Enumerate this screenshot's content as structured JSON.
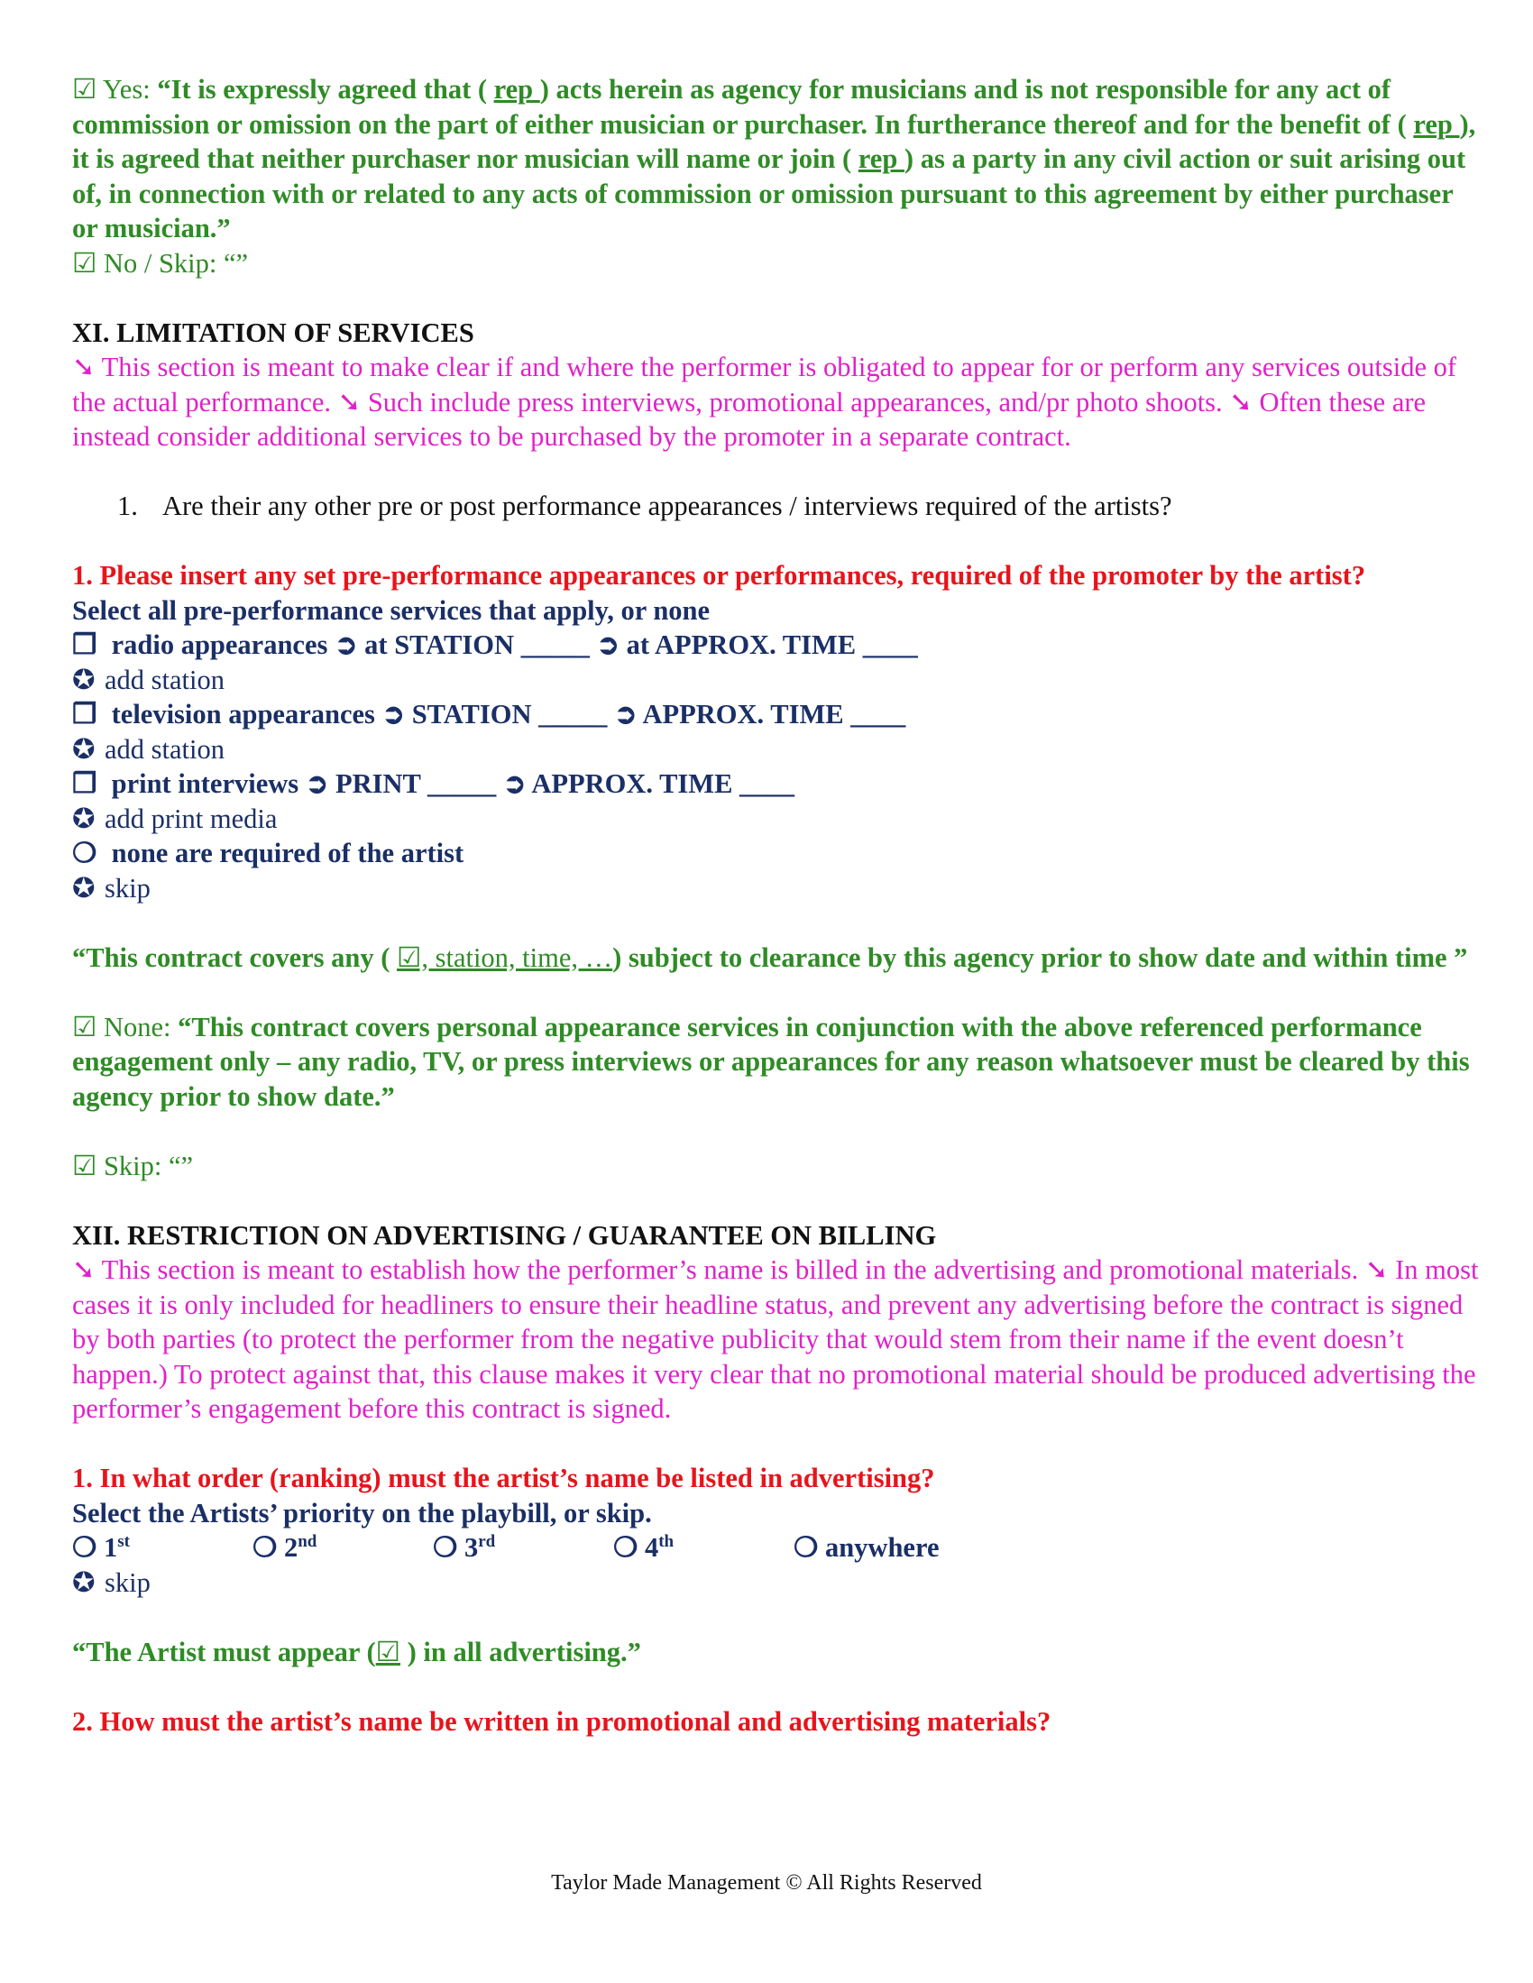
{
  "clause_top": {
    "yes_prefix": "☑ Yes: ",
    "yes_t1": "“It is expressly agreed that ( ",
    "rep1": "rep ",
    "yes_t2": ") acts herein as agency for musicians and is not responsible for any act of commission or omission on the part of either musician or purchaser. In furtherance thereof and for the benefit of ( ",
    "rep2": "rep ",
    "yes_t3": "), it is agreed that neither purchaser nor musician will name or join ( ",
    "rep3": "rep ",
    "yes_t4": ") as a party in any civil action or suit arising out of, in connection with or related to any acts of commission or omission pursuant to this agreement by either purchaser or musician.”",
    "no_line": "☑ No / Skip: “”"
  },
  "section11": {
    "heading": "XI. LIMITATION OF SERVICES",
    "note": "➘ This section is meant to make clear if and where the performer is obligated to appear for or perform any services outside of the actual performance. ➘ Such include press interviews, promotional appearances, and/pr photo shoots. ➘ Often these are instead consider additional services to be purchased by the promoter in a separate contract.",
    "list_num": "1.",
    "list_item": "Are their any other pre or post performance appearances / interviews required of the artists?",
    "question": "1. Please insert any set pre-performance appearances or performances, required of the promoter by the artist?",
    "instruction": "Select all pre-performance services that apply, or none",
    "options": [
      {
        "sym": "❒",
        "label": " radio appearances ➲ at STATION _____ ➲ at APPROX. TIME ____"
      },
      {
        "sym": "✪",
        "label": "add station"
      },
      {
        "sym": "❒",
        "label": " television appearances ➲ STATION _____ ➲ APPROX. TIME ____"
      },
      {
        "sym": "✪",
        "label": "add station"
      },
      {
        "sym": "❒",
        "label": " print interviews ➲ PRINT _____ ➲ APPROX. TIME ____"
      },
      {
        "sym": "✪",
        "label": "add print media"
      },
      {
        "sym": "❍",
        "label": " none are required of the artist"
      },
      {
        "sym": "✪",
        "label": "skip"
      }
    ],
    "contract_t1": "“This contract covers any ( ",
    "contract_fill": "☑, station, time, …",
    "contract_t2": ") subject to clearance by this agency prior to show date and within time ”",
    "none_prefix": "☑ None: ",
    "none_text": "“This contract covers personal appearance services in conjunction with the above referenced performance engagement only – any radio, TV, or press interviews or appearances for any reason whatsoever must be cleared by this agency prior to show date.”",
    "skip_line": "☑ Skip: “”"
  },
  "section12": {
    "heading": "XII. RESTRICTION ON ADVERTISING / GUARANTEE ON BILLING",
    "note": "➘ This section is meant to establish how the performer’s name is billed in the advertising and promotional materials. ➘ In most cases it is only included for headliners to ensure their headline status, and prevent any advertising before the contract is signed by both parties (to protect the performer from the negative publicity that would stem from their name if the event doesn’t happen.)  To protect against that, this clause makes it very clear that no promotional material should be produced advertising the performer’s engagement before this contract is signed.",
    "question1": "1. In what order (ranking) must the artist’s name be listed in advertising?",
    "instruction1": "Select the Artists’ priority on the playbill, or skip.",
    "rank_options": [
      {
        "sym": "❍",
        "num": "1",
        "sup": "st"
      },
      {
        "sym": "❍",
        "num": "2",
        "sup": "nd"
      },
      {
        "sym": "❍",
        "num": "3",
        "sup": "rd"
      },
      {
        "sym": "❍",
        "num": "4",
        "sup": "th"
      },
      {
        "sym": "❍",
        "num": "anywhere",
        "sup": ""
      }
    ],
    "skip_sym": "✪",
    "skip_label": "skip",
    "appear_t1": "“The Artist must appear (",
    "appear_fill": "☑",
    "appear_t2": " ) in all advertising.”",
    "question2": "2. How must the artist’s name be written in promotional and advertising materials?"
  },
  "footer": "Taylor Made Management © All Rights Reserved"
}
